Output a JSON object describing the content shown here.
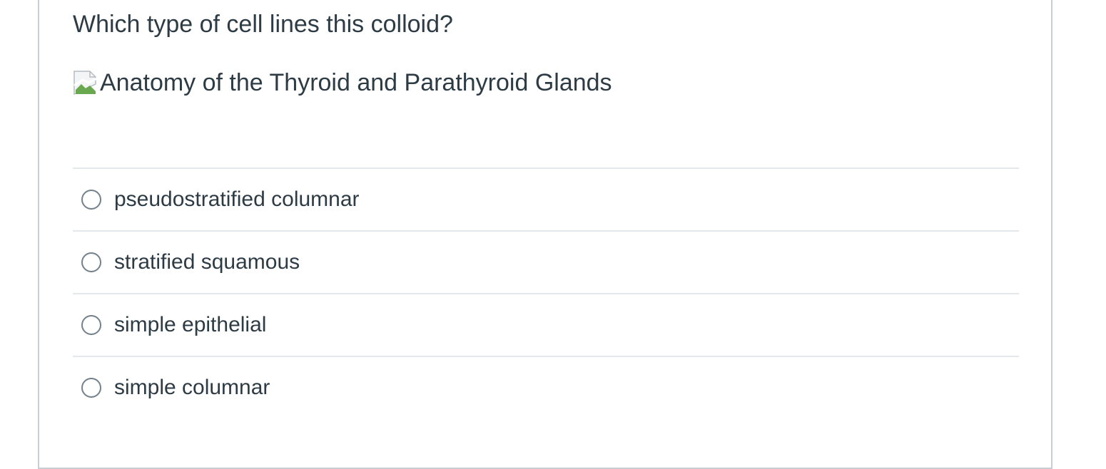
{
  "question": {
    "text": "Which type of cell lines this colloid?",
    "image_alt": "Anatomy of the Thyroid and Parathyroid Glands",
    "image_icon": "broken-image-icon"
  },
  "answers": [
    {
      "label": "pseudostratified columnar",
      "selected": false
    },
    {
      "label": "stratified squamous",
      "selected": false
    },
    {
      "label": "simple epithelial",
      "selected": false
    },
    {
      "label": "simple columnar",
      "selected": false
    }
  ],
  "colors": {
    "text": "#2d3b45",
    "border": "#c7cdd1",
    "divider": "#e5e8ea",
    "radio_border": "#73818c"
  }
}
